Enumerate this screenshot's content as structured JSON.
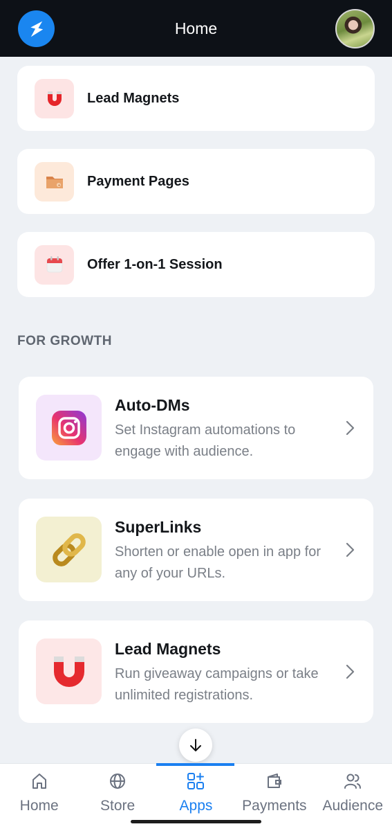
{
  "header": {
    "title": "Home",
    "logo_icon": "lightning-logo-icon",
    "avatar": "profile-avatar"
  },
  "top_cards": [
    {
      "label": "Lead Magnets",
      "icon": "magnet-icon"
    },
    {
      "label": "Payment Pages",
      "icon": "folder-payment-icon"
    },
    {
      "label": "Offer 1-on-1 Session",
      "icon": "calendar-icon"
    }
  ],
  "section": {
    "title": "FOR GROWTH"
  },
  "features": [
    {
      "title": "Auto-DMs",
      "description": "Set Instagram automations to engage with audience.",
      "icon": "instagram-icon"
    },
    {
      "title": "SuperLinks",
      "description": "Shorten or enable open in app for any of your URLs.",
      "icon": "chain-link-icon"
    },
    {
      "title": "Lead Magnets",
      "description": "Run giveaway campaigns or take unlimited registrations.",
      "icon": "magnet-icon"
    }
  ],
  "bottom_nav": {
    "items": [
      {
        "label": "Home",
        "icon": "home-icon",
        "active": false
      },
      {
        "label": "Store",
        "icon": "globe-icon",
        "active": false
      },
      {
        "label": "Apps",
        "icon": "apps-grid-icon",
        "active": true
      },
      {
        "label": "Payments",
        "icon": "wallet-icon",
        "active": false
      },
      {
        "label": "Audience",
        "icon": "users-icon",
        "active": false
      }
    ]
  },
  "colors": {
    "accent": "#1a7ff0",
    "header_bg": "#0d1117",
    "page_bg": "#eef1f5"
  }
}
